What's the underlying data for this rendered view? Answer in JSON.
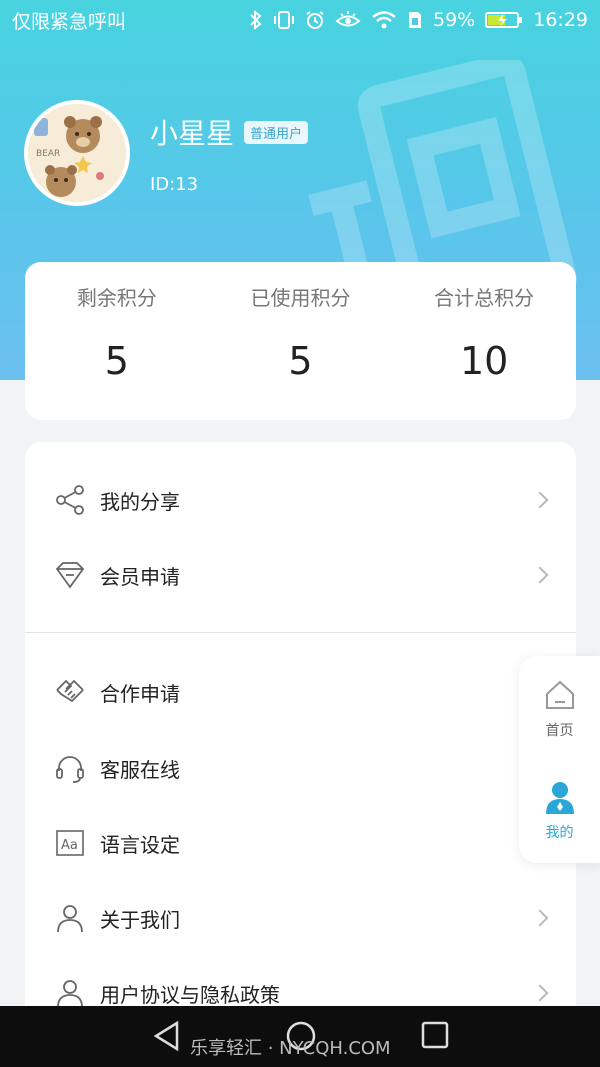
{
  "status_bar": {
    "carrier": "仅限紧急呼叫",
    "battery": "59%",
    "time": "16:29"
  },
  "profile": {
    "name": "小星星",
    "badge": "普通用户",
    "id": "ID:13",
    "avatar_text": "BEAR"
  },
  "points": [
    {
      "label": "剩余积分",
      "value": "5"
    },
    {
      "label": "已使用积分",
      "value": "5"
    },
    {
      "label": "合计总积分",
      "value": "10"
    }
  ],
  "menu": [
    {
      "label": "我的分享",
      "icon": "share-icon"
    },
    {
      "label": "会员申请",
      "icon": "diamond-icon"
    },
    {
      "label": "合作申请",
      "icon": "handshake-icon"
    },
    {
      "label": "客服在线",
      "icon": "headset-icon"
    },
    {
      "label": "语言设定",
      "icon": "language-icon",
      "icon_text": "Aa"
    },
    {
      "label": "关于我们",
      "icon": "user-icon"
    },
    {
      "label": "用户协议与隐私政策",
      "icon": "user-icon"
    }
  ],
  "side_nav": {
    "home_label": "首页",
    "mine_label": "我的"
  },
  "bottom_bar": {
    "watermark": "乐享轻汇 · NYCQH.COM"
  },
  "colors": {
    "header_gradient_top": "#48d3df",
    "header_gradient_bottom": "#6cc0f0",
    "accent": "#29a8d8",
    "background": "#f2f3f5"
  }
}
